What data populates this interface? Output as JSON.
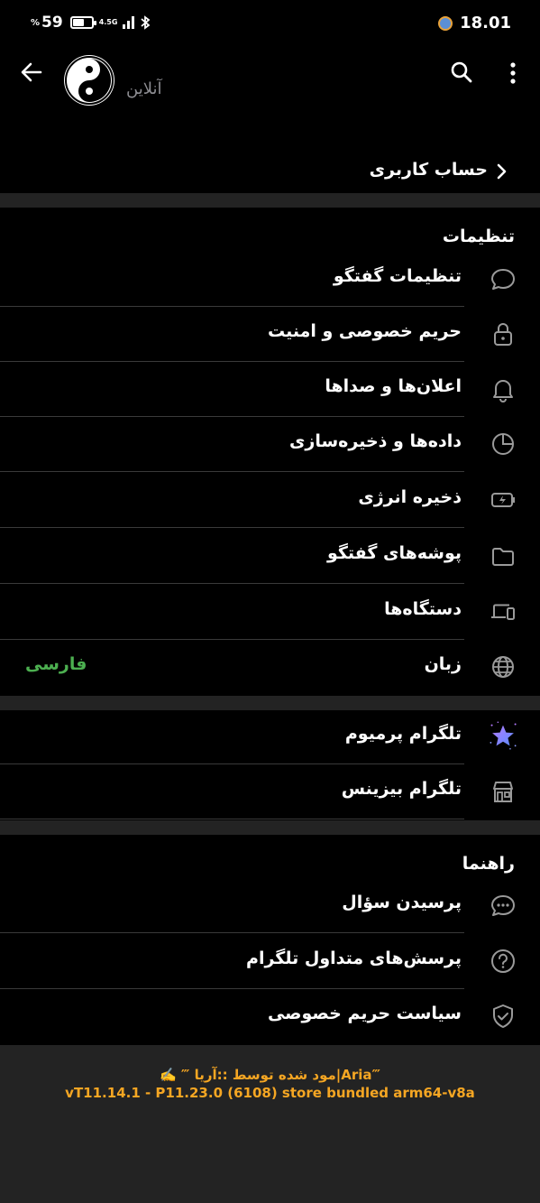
{
  "status_bar": {
    "battery_percent_sign": "%",
    "battery": "59",
    "network": "4.5G",
    "time": "18.01"
  },
  "header": {
    "status": "آنلاین"
  },
  "account": {
    "label": "حساب کاربری"
  },
  "settings": {
    "title": "تنظیمات",
    "items": [
      {
        "label": "تنظیمات گفتگو",
        "icon": "chat-bubble-icon"
      },
      {
        "label": "حریم خصوصی و امنیت",
        "icon": "lock-icon"
      },
      {
        "label": "اعلان‌ها و صداها",
        "icon": "bell-icon"
      },
      {
        "label": "داده‌ها و ذخیره‌سازی",
        "icon": "pie-chart-icon"
      },
      {
        "label": "ذخیره انرژی",
        "icon": "battery-charging-icon"
      },
      {
        "label": "پوشه‌های گفتگو",
        "icon": "folder-icon"
      },
      {
        "label": "دستگاه‌ها",
        "icon": "devices-icon"
      },
      {
        "label": "زبان",
        "icon": "globe-icon",
        "value": "فارسی"
      }
    ]
  },
  "premium": {
    "items": [
      {
        "label": "تلگرام پرمیوم",
        "icon": "premium-star-icon"
      },
      {
        "label": "تلگرام بیزینس",
        "icon": "store-icon"
      }
    ]
  },
  "help": {
    "title": "راهنما",
    "items": [
      {
        "label": "پرسیدن سؤال",
        "icon": "chat-dots-icon"
      },
      {
        "label": "پرسش‌های متداول تلگرام",
        "icon": "question-icon"
      },
      {
        "label": "سیاست حریم خصوصی",
        "icon": "shield-check-icon"
      }
    ]
  },
  "footer": {
    "line1": "✍️ ‴ مود شده توسط ::آریا|Aria‴",
    "line2": "vT11.14.1 - P11.23.0 (6108) store bundled arm64-v8a"
  },
  "colors": {
    "background": "#000000",
    "section_gap": "#232323",
    "accent_green": "#4caf50",
    "footer_text": "#f5a623",
    "premium_star": "#8c6cf0"
  }
}
